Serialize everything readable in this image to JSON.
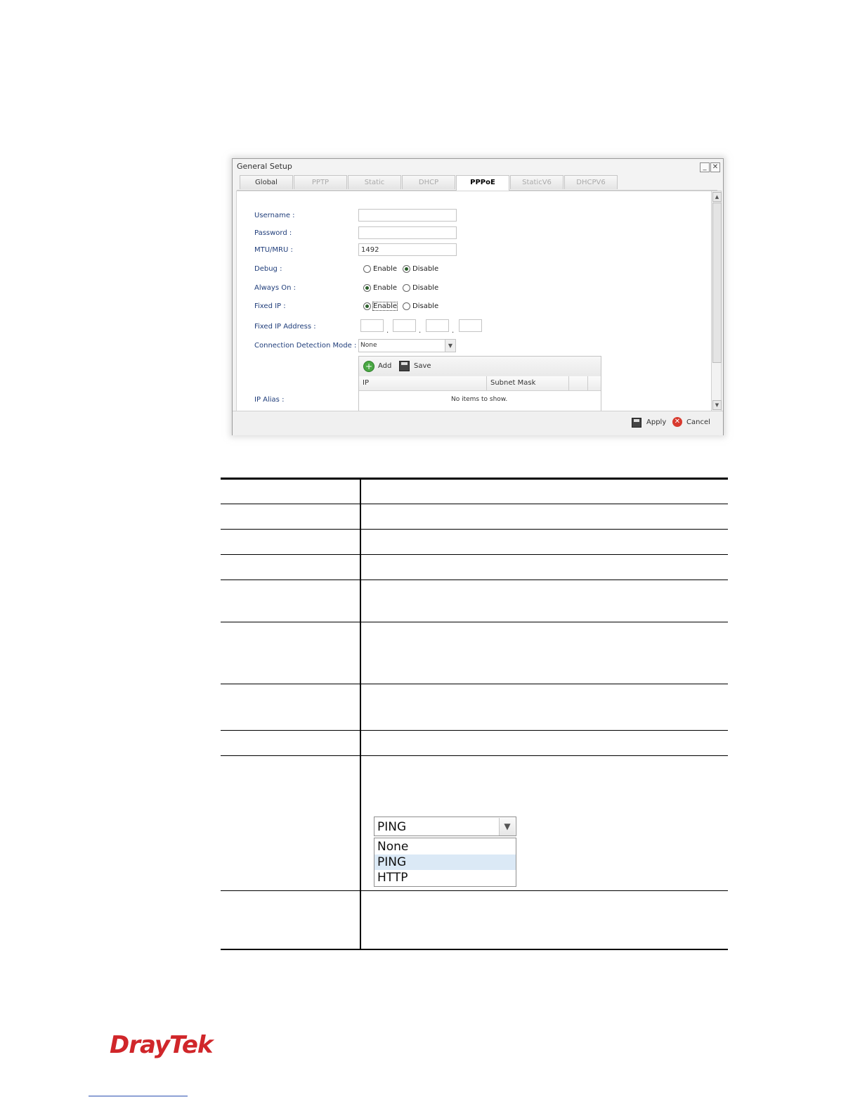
{
  "dialog": {
    "title": "General Setup",
    "minimize": "_",
    "close": "✕",
    "tabs": [
      {
        "label": "Global",
        "state": "inactive"
      },
      {
        "label": "PPTP",
        "state": "disabled"
      },
      {
        "label": "Static",
        "state": "disabled"
      },
      {
        "label": "DHCP",
        "state": "disabled"
      },
      {
        "label": "PPPoE",
        "state": "active"
      },
      {
        "label": "StaticV6",
        "state": "disabled"
      },
      {
        "label": "DHCPV6",
        "state": "disabled"
      }
    ],
    "form": {
      "username_label": "Username :",
      "username_value": "",
      "password_label": "Password :",
      "password_value": "",
      "mtu_label": "MTU/MRU :",
      "mtu_value": "1492",
      "debug_label": "Debug :",
      "always_on_label": "Always On :",
      "fixed_ip_label": "Fixed IP :",
      "enable_label": "Enable",
      "disable_label": "Disable",
      "debug_selected": "Disable",
      "always_on_selected": "Enable",
      "fixed_ip_selected": "Enable",
      "fixed_ip_address_label": "Fixed IP Address :",
      "ip_dot": ".",
      "connection_detection_label": "Connection Detection Mode :",
      "connection_detection_value": "None",
      "ip_alias_label": "IP Alias :"
    },
    "ip_alias_grid": {
      "add_label": "Add",
      "save_label": "Save",
      "col_ip": "IP",
      "col_subnet": "Subnet Mask",
      "empty_text": "No items to show."
    },
    "footer": {
      "apply_label": "Apply",
      "cancel_label": "Cancel"
    }
  },
  "dropdown_example": {
    "selected": "PING",
    "options": [
      "None",
      "PING",
      "HTTP"
    ],
    "highlighted": "PING"
  },
  "brand": {
    "logo_text": "DrayTek",
    "color": "#d0262a"
  }
}
